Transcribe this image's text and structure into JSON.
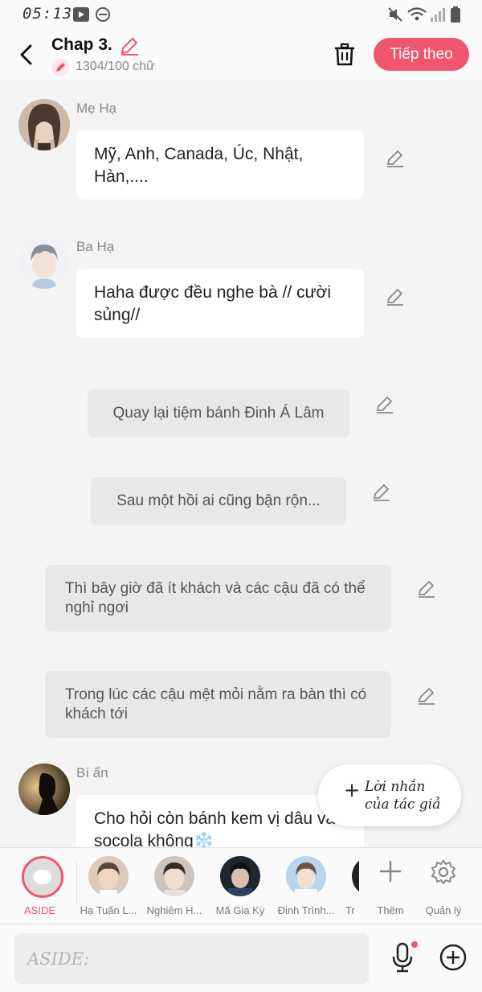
{
  "status_bar": {
    "time": "05:13"
  },
  "header": {
    "title": "Chap 3.",
    "word_count": "1304/100 chữ",
    "next_label": "Tiếp theo"
  },
  "messages": [
    {
      "type": "chat",
      "sender": "Mẹ Hạ",
      "text": "Mỹ, Anh, Canada, Úc, Nhật, Hàn,...."
    },
    {
      "type": "chat",
      "sender": "Ba Hạ",
      "text": "Haha được đều nghe bà // cười sủng//"
    },
    {
      "type": "narration",
      "text": "Quay lại tiệm bánh Đinh Á Lâm"
    },
    {
      "type": "narration",
      "text": "Sau một hồi ai cũng bận rộn..."
    },
    {
      "type": "narration",
      "text": "Thì bây giờ đã ít khách và các cậu đã có thể nghỉ ngơi"
    },
    {
      "type": "narration",
      "text": "Trong lúc các cậu mệt mỏi nằm ra bàn thì có khách tới"
    },
    {
      "type": "chat",
      "sender": "Bí ẩn",
      "text": "Cho hỏi còn bánh kem vị dâu và socola không❄️"
    }
  ],
  "author_note": {
    "line1": "Lời nhắn",
    "line2": "của tác giả"
  },
  "characters": {
    "aside_label": "ASIDE",
    "items": [
      "Hạ Tuấn L...",
      "Nghiêm H...",
      "Mã Gia Kỳ",
      "Đinh Trình...",
      "Tr"
    ],
    "add_label": "Thêm",
    "manage_label": "Quản lý"
  },
  "input": {
    "placeholder": "ASIDE:"
  },
  "colors": {
    "accent": "#f2566f",
    "background": "#f4f4f4"
  }
}
